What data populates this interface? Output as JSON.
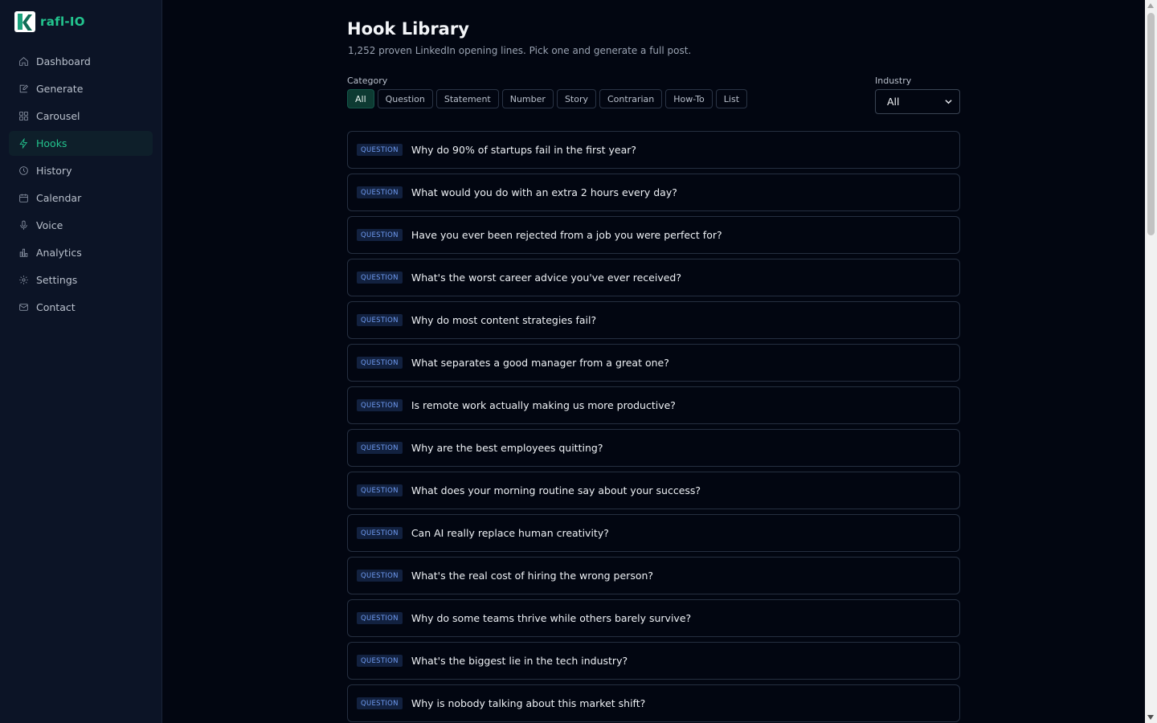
{
  "brand": {
    "name": "rafl-IO"
  },
  "nav": [
    {
      "label": "Dashboard",
      "icon": "home-icon"
    },
    {
      "label": "Generate",
      "icon": "edit-icon"
    },
    {
      "label": "Carousel",
      "icon": "grid-icon"
    },
    {
      "label": "Hooks",
      "icon": "bolt-icon",
      "active": true
    },
    {
      "label": "History",
      "icon": "clock-icon"
    },
    {
      "label": "Calendar",
      "icon": "calendar-icon"
    },
    {
      "label": "Voice",
      "icon": "mic-icon"
    },
    {
      "label": "Analytics",
      "icon": "bar-chart-icon"
    },
    {
      "label": "Settings",
      "icon": "gear-icon"
    },
    {
      "label": "Contact",
      "icon": "mail-icon"
    }
  ],
  "page": {
    "title": "Hook Library",
    "subtitle": "1,252 proven LinkedIn opening lines. Pick one and generate a full post."
  },
  "filters": {
    "category_label": "Category",
    "categories": [
      "All",
      "Question",
      "Statement",
      "Number",
      "Story",
      "Contrarian",
      "How-To",
      "List"
    ],
    "selected_category": "All",
    "industry_label": "Industry",
    "industry_value": "All"
  },
  "hooks": [
    {
      "tag": "QUESTION",
      "text": "Why do 90% of startups fail in the first year?"
    },
    {
      "tag": "QUESTION",
      "text": "What would you do with an extra 2 hours every day?"
    },
    {
      "tag": "QUESTION",
      "text": "Have you ever been rejected from a job you were perfect for?"
    },
    {
      "tag": "QUESTION",
      "text": "What's the worst career advice you've ever received?"
    },
    {
      "tag": "QUESTION",
      "text": "Why do most content strategies fail?"
    },
    {
      "tag": "QUESTION",
      "text": "What separates a good manager from a great one?"
    },
    {
      "tag": "QUESTION",
      "text": "Is remote work actually making us more productive?"
    },
    {
      "tag": "QUESTION",
      "text": "Why are the best employees quitting?"
    },
    {
      "tag": "QUESTION",
      "text": "What does your morning routine say about your success?"
    },
    {
      "tag": "QUESTION",
      "text": "Can AI really replace human creativity?"
    },
    {
      "tag": "QUESTION",
      "text": "What's the real cost of hiring the wrong person?"
    },
    {
      "tag": "QUESTION",
      "text": "Why do some teams thrive while others barely survive?"
    },
    {
      "tag": "QUESTION",
      "text": "What's the biggest lie in the tech industry?"
    },
    {
      "tag": "QUESTION",
      "text": "Why is nobody talking about this market shift?"
    }
  ],
  "colors": {
    "background": "#020611",
    "sidebar": "#0c1426",
    "accent": "#23c48e",
    "badge_text": "#6f9bf2",
    "badge_bg": "#12213f"
  }
}
